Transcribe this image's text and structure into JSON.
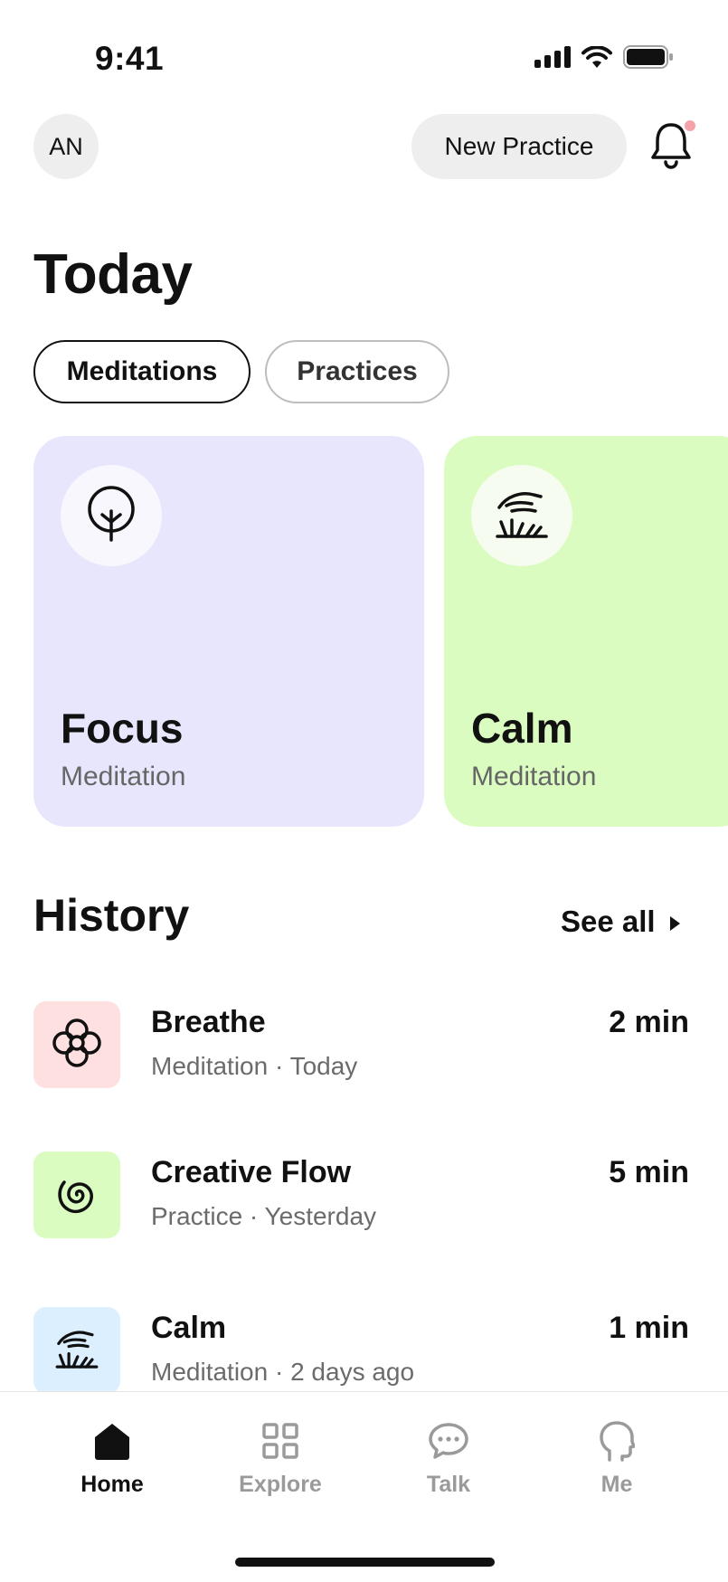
{
  "status_bar": {
    "time": "9:41",
    "icons": [
      "signal-icon",
      "wifi-icon",
      "battery-icon"
    ]
  },
  "header": {
    "avatar_initials": "AN",
    "new_practice_label": "New Practice",
    "notification_icon": "bell-icon",
    "has_unread": true
  },
  "page": {
    "title": "Today"
  },
  "tabs": [
    {
      "label": "Meditations",
      "active": true
    },
    {
      "label": "Practices",
      "active": false
    }
  ],
  "cards": [
    {
      "title": "Focus",
      "subtitle": "Meditation",
      "icon": "tree-icon",
      "color": "#e7e6fd"
    },
    {
      "title": "Calm",
      "subtitle": "Meditation",
      "icon": "hand-grass-icon",
      "color": "#dafcc1"
    }
  ],
  "history": {
    "title": "History",
    "see_all_label": "See all",
    "items": [
      {
        "name": "Breathe",
        "meta": "Meditation · Today",
        "duration": "2 min",
        "icon": "flower-icon",
        "color": "#fde0df"
      },
      {
        "name": "Creative Flow",
        "meta": "Practice · Yesterday",
        "duration": "5 min",
        "icon": "spiral-icon",
        "color": "#dafcc1"
      },
      {
        "name": "Calm",
        "meta": "Meditation · 2 days ago",
        "duration": "1 min",
        "icon": "hand-grass-icon",
        "color": "#dcefff"
      }
    ]
  },
  "bottom_nav": [
    {
      "label": "Home",
      "icon": "home-icon",
      "active": true
    },
    {
      "label": "Explore",
      "icon": "grid-icon",
      "active": false
    },
    {
      "label": "Talk",
      "icon": "chat-bubble-icon",
      "active": false
    },
    {
      "label": "Me",
      "icon": "head-profile-icon",
      "active": false
    }
  ]
}
